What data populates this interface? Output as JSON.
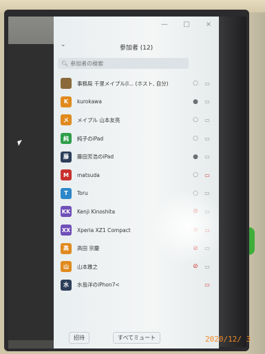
{
  "window_controls": [
    "—",
    "□",
    "×"
  ],
  "panel": {
    "title": "参加者 (12)",
    "collapse_icon": "chevron-down-icon",
    "search_placeholder": "参加者の検索"
  },
  "participants": [
    {
      "name": "事務局 千里メイプル(I... (ホスト, 自分)",
      "initial": "",
      "color": "#8a6a3a",
      "mic": "off",
      "cam": "on"
    },
    {
      "name": "kurokawa",
      "initial": "K",
      "color": "#e08a1e",
      "mic": "on",
      "cam": "on"
    },
    {
      "name": "メイプル 山本友亮",
      "initial": "メ",
      "color": "#e08a1e",
      "mic": "off",
      "cam": "on"
    },
    {
      "name": "純子のiPad",
      "initial": "純",
      "color": "#2e9e4a",
      "mic": "off",
      "cam": "on"
    },
    {
      "name": "藤田芳浩のiPad",
      "initial": "藤",
      "color": "#2c3e5a",
      "mic": "on",
      "cam": "on"
    },
    {
      "name": "matsuda",
      "initial": "M",
      "color": "#c8312e",
      "mic": "off",
      "cam": "muted"
    },
    {
      "name": "Toru",
      "initial": "T",
      "color": "#2d86c8",
      "mic": "off",
      "cam": "on"
    },
    {
      "name": "Kenji Kinoshita",
      "initial": "KK",
      "color": "#6f4fb8",
      "mic": "muted",
      "cam": "on"
    },
    {
      "name": "Xperia XZ1 Compact",
      "initial": "XX",
      "color": "#6f4fb8",
      "mic": "muted",
      "cam": "muted"
    },
    {
      "name": "高田 宗慶",
      "initial": "高",
      "color": "#e08a1e",
      "mic": "muted",
      "cam": "on"
    },
    {
      "name": "山本雅之",
      "initial": "山",
      "color": "#e08a1e",
      "mic": "muted",
      "cam": "on"
    },
    {
      "name": "水島洋のiPhon7<",
      "initial": "水",
      "color": "#2c3e5a",
      "mic": "",
      "cam": "muted"
    }
  ],
  "footer": {
    "invite_label": "招待",
    "mute_all_label": "すべてミュート"
  },
  "photo_timestamp": "2020/12/ 3"
}
